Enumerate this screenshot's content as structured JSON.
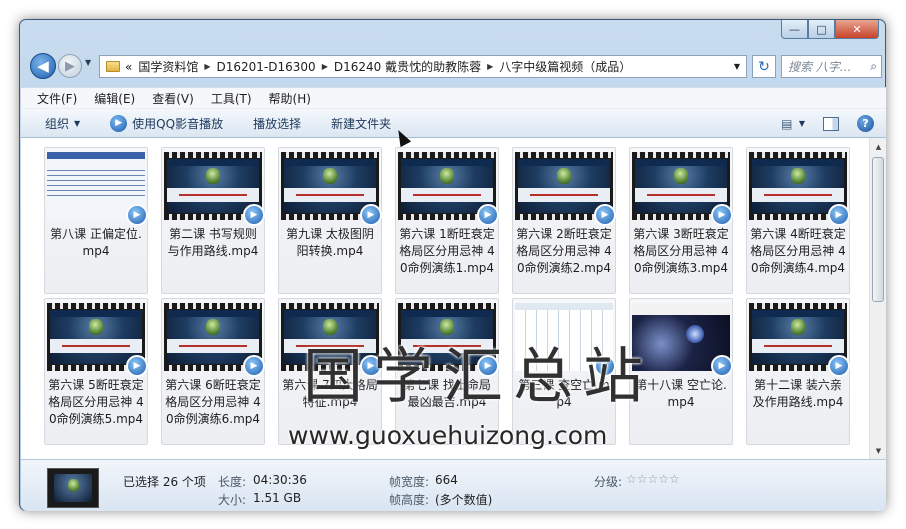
{
  "window": {
    "caption_buttons": {
      "minimize": "—",
      "maximize": "□",
      "close": "✕"
    }
  },
  "nav": {
    "back_glyph": "◀",
    "forward_glyph": "▶",
    "history_glyph": "▼",
    "address": {
      "prefix": "«",
      "segments": [
        "国学资料馆",
        "D16201-D16300",
        "D16240 戴贵忱的助教陈蓉",
        "八字中级篇视频（成品）"
      ],
      "separator": "▶",
      "dropdown": "▼"
    },
    "refresh_glyph": "↻",
    "search": {
      "placeholder": "搜索 八字...",
      "icon": "search-icon",
      "glyph": "⌕"
    }
  },
  "menu": [
    "文件(F)",
    "编辑(E)",
    "查看(V)",
    "工具(T)",
    "帮助(H)"
  ],
  "toolbar": {
    "organize": "组织",
    "play_qq": "使用QQ影音播放",
    "play_selection": "播放选择",
    "new_folder": "新建文件夹",
    "dropdown_arrow": "▼",
    "help_glyph": "?",
    "view_glyph": "▤"
  },
  "files": [
    {
      "name": "第八课 正偏定位.mp4",
      "thumb": "doc"
    },
    {
      "name": "第二课 书写规则与作用路线.mp4",
      "thumb": "film"
    },
    {
      "name": "第九课 太极图阴阳转换.mp4",
      "thumb": "film"
    },
    {
      "name": "第六课 1断旺衰定格局区分用忌神 40命例演练1.mp4",
      "thumb": "film"
    },
    {
      "name": "第六课 2断旺衰定格局区分用忌神 40命例演练2.mp4",
      "thumb": "film"
    },
    {
      "name": "第六课 3断旺衰定格局区分用忌神 40命例演练3.mp4",
      "thumb": "film"
    },
    {
      "name": "第六课 4断旺衰定格局区分用忌神 40命例演练4.mp4",
      "thumb": "film"
    },
    {
      "name": "第六课 5断旺衰定格局区分用忌神 40命例演练5.mp4",
      "thumb": "film"
    },
    {
      "name": "第六课 6断旺衰定格局区分用忌神 40命例演练6.mp4",
      "thumb": "film"
    },
    {
      "name": "第六课 7四大格局特征.mp4",
      "thumb": "film"
    },
    {
      "name": "第七课 找出命局最凶最吉.mp4",
      "thumb": "film"
    },
    {
      "name": "第三课 查空亡.mp4",
      "thumb": "table"
    },
    {
      "name": "第十八课 空亡论.mp4",
      "thumb": "space"
    },
    {
      "name": "第十二课 装六亲及作用路线.mp4",
      "thumb": "film"
    }
  ],
  "badge_glyph": "▶",
  "watermark": {
    "text": "国学汇总站",
    "url": "www.guoxuehuizong.com"
  },
  "scrollbar": {
    "up": "▲",
    "down": "▼"
  },
  "details": {
    "selected": "已选择 26 个项",
    "length_label": "长度:",
    "length_value": "04:30:36",
    "size_label": "大小:",
    "size_value": "1.51 GB",
    "frame_width_label": "帧宽度:",
    "frame_width_value": "664",
    "frame_height_label": "帧高度:",
    "frame_height_value": "(多个数值)",
    "rating_label": "分级:",
    "rating_stars": "☆☆☆☆☆"
  },
  "colors": {
    "accent": "#1e5eb0",
    "frame": "#a9c6e3",
    "window_border": "#3c5a78"
  }
}
